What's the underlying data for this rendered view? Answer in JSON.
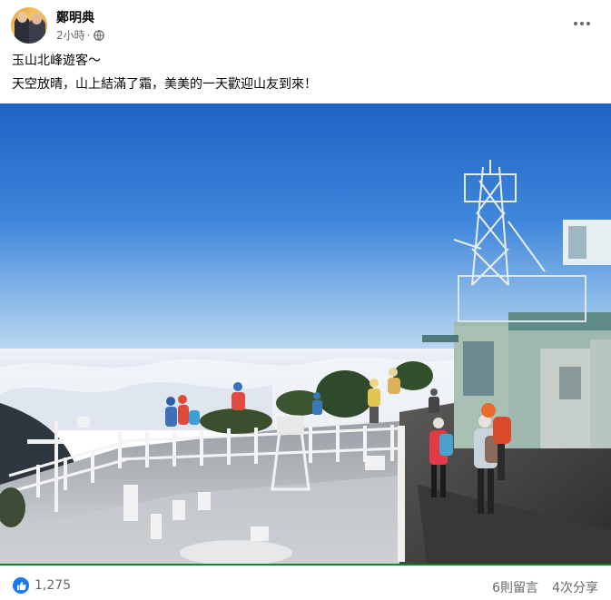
{
  "post": {
    "author": "鄭明典",
    "time": "2小時",
    "separator": "·",
    "audience_icon": "globe-icon",
    "more_icon": "more-horizontal-icon",
    "text_lines": [
      "玉山北峰遊客～",
      "天空放晴，山上結滿了霜，美美的一天歡迎山友到來！"
    ]
  },
  "photo": {
    "description_icon": "mountain-summit-photo"
  },
  "footer": {
    "reaction_icon": "like-icon",
    "reactions": "1,275",
    "comments": "6則留言",
    "shares": "4次分享"
  },
  "colors": {
    "accent": "#1877f2",
    "secondary_text": "#65676b",
    "sky_top": "#1e63c4",
    "sky_bottom": "#9cc3ea"
  }
}
